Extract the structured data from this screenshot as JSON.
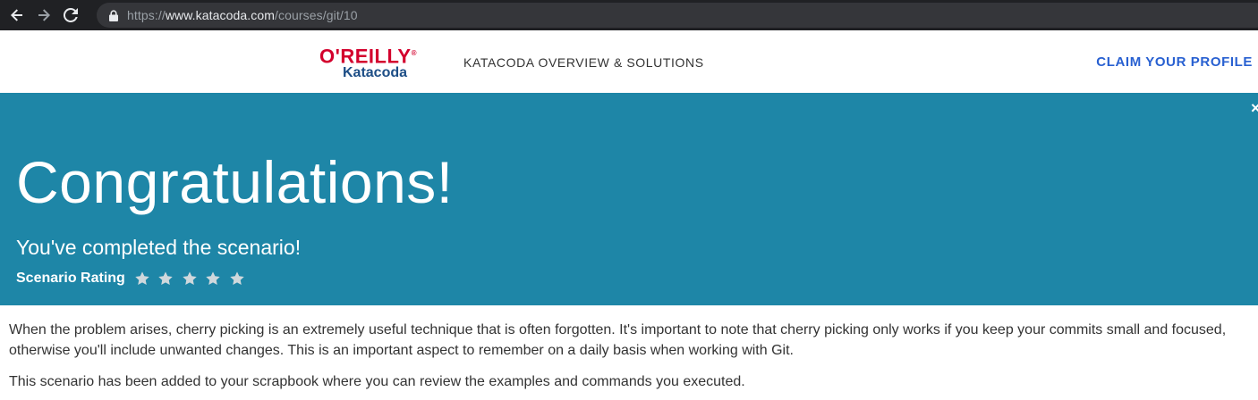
{
  "browser": {
    "url_prefix": "https://",
    "url_host": "www.katacoda.com",
    "url_path": "/courses/git/10"
  },
  "header": {
    "logo_top": "O'REILLY",
    "logo_registered": "®",
    "logo_bottom": "Katacoda",
    "nav_link": "KATACODA OVERVIEW & SOLUTIONS",
    "claim_link": "CLAIM YOUR PROFILE"
  },
  "hero": {
    "title": "Congratulations!",
    "subtitle": "You've completed the scenario!",
    "rating_label": "Scenario Rating",
    "star_count": 5,
    "close_glyph": "×"
  },
  "content": {
    "paragraph1": "When the problem arises, cherry picking is an extremely useful technique that is often forgotten. It's important to note that cherry picking only works if you keep your commits small and focused, otherwise you'll include unwanted changes. This is an important aspect to remember on a daily basis when working with Git.",
    "paragraph2": "This scenario has been added to your scrapbook where you can review the examples and commands you executed."
  },
  "colors": {
    "browser_bg": "#202124",
    "address_bg": "#35363a",
    "hero_bg": "#1e86a7",
    "brand_red": "#d3002d",
    "brand_blue": "#1d4e86",
    "link_blue": "#2860d1",
    "star": "#cfd8dc"
  }
}
